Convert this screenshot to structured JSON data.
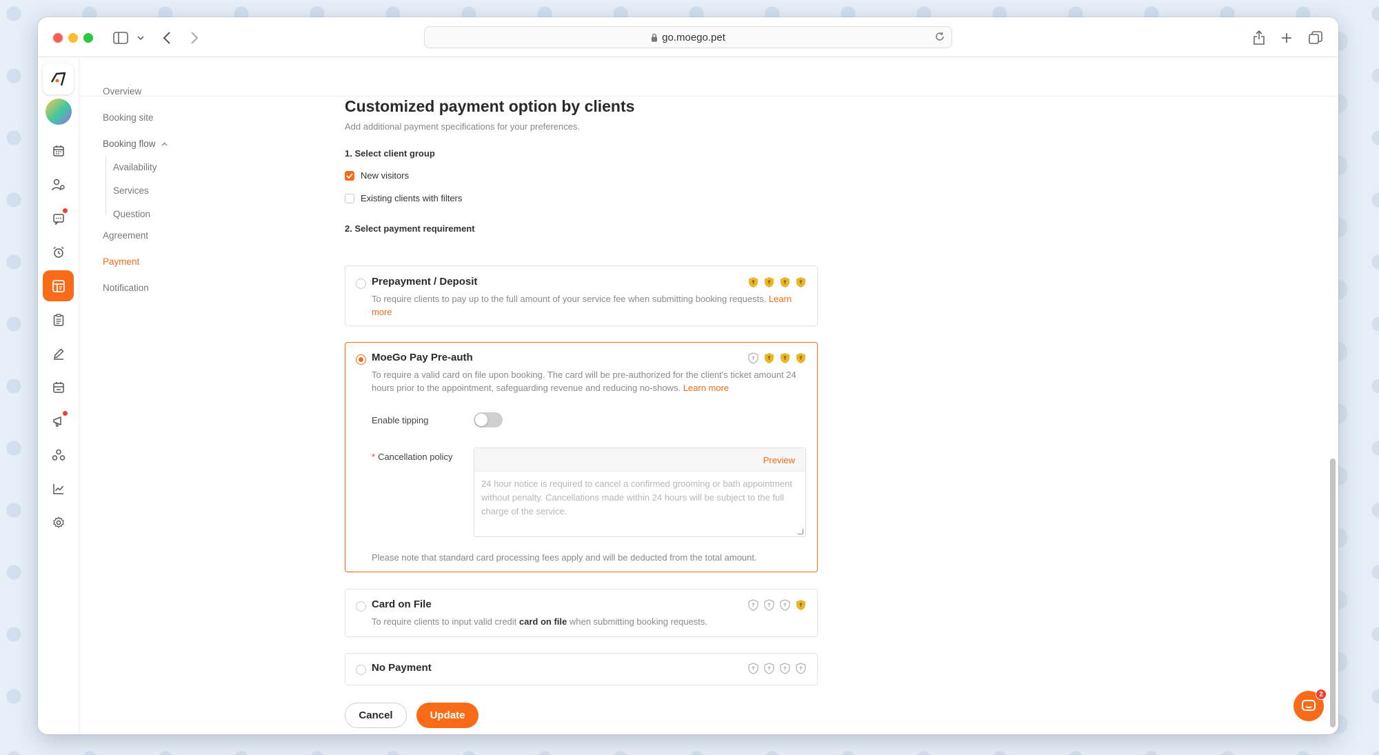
{
  "browser": {
    "url": "go.moego.pet"
  },
  "nav": {
    "items": [
      {
        "label": "Overview"
      },
      {
        "label": "Booking site"
      },
      {
        "label": "Booking flow"
      },
      {
        "label": "Availability"
      },
      {
        "label": "Services"
      },
      {
        "label": "Question"
      },
      {
        "label": "Agreement"
      },
      {
        "label": "Payment"
      },
      {
        "label": "Notification"
      }
    ]
  },
  "page": {
    "title": "Customized payment option by clients",
    "subtitle": "Add additional payment specifications for your preferences."
  },
  "client_group": {
    "label": "1. Select client group",
    "options": [
      {
        "label": "New visitors",
        "checked": true
      },
      {
        "label": "Existing clients with filters",
        "checked": false
      }
    ]
  },
  "payment": {
    "label": "2. Select payment requirement",
    "learn_more": "Learn more",
    "prepay": {
      "title": "Prepayment / Deposit",
      "desc": "To require clients to pay up to the full amount of your service fee when submitting booking requests."
    },
    "preauth": {
      "title": "MoeGo Pay Pre-auth",
      "desc": "To require a valid card on file upon booking. The card will be pre-authorized for the client's ticket amount 24 hours prior to the appointment, safeguarding revenue and reducing no-shows.",
      "tipping_label": "Enable tipping",
      "tipping_on": false,
      "policy_required": "*",
      "policy_label": "Cancellation policy",
      "preview": "Preview",
      "policy_placeholder": "24 hour notice is required to cancel a confirmed grooming or bath appointment without penalty. Cancellations made within 24 hours will be subject to the full charge of the service.",
      "note": "Please note that standard card processing fees apply and will be deducted from the total amount."
    },
    "card_on_file": {
      "title": "Card on File",
      "desc_before": "To require clients to input valid credit ",
      "desc_bold": "card on file",
      "desc_after": " when submitting booking requests."
    },
    "no_payment": {
      "title": "No Payment"
    }
  },
  "actions": {
    "cancel": "Cancel",
    "update": "Update"
  },
  "chat": {
    "badge": "2"
  },
  "colors": {
    "accent": "#f96b18",
    "shield_gold": "#e9b62a",
    "shield_grey": "#b5b5b5",
    "alert_dot": "#f53d2d"
  }
}
